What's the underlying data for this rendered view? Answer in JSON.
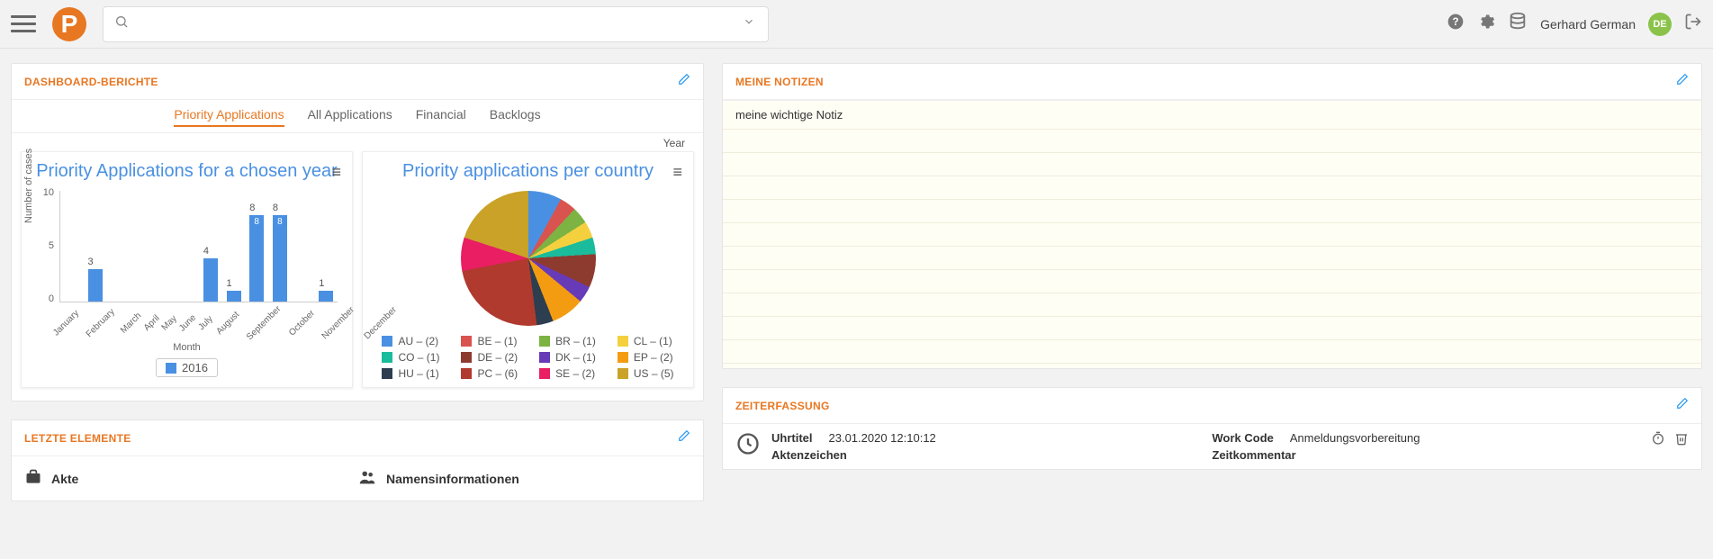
{
  "header": {
    "search_placeholder": "",
    "user_name": "Gerhard German",
    "avatar_initials": "DE"
  },
  "panels": {
    "dashboard": {
      "title": "DASHBOARD-BERICHTE",
      "tabs": [
        "Priority Applications",
        "All Applications",
        "Financial",
        "Backlogs"
      ],
      "active_tab": 0,
      "year_label": "Year"
    },
    "notes": {
      "title": "MEINE NOTIZEN",
      "lines": [
        "meine wichtige Notiz"
      ]
    },
    "recent": {
      "title": "LETZTE ELEMENTE",
      "cols": [
        {
          "icon": "briefcase",
          "label": "Akte"
        },
        {
          "icon": "people",
          "label": "Namensinformationen"
        }
      ]
    },
    "time": {
      "title": "ZEITERFASSUNG",
      "row_label_a": "Uhrtitel",
      "timestamp": "23.01.2020 12:10:12",
      "row_label_b": "Aktenzeichen",
      "workcode_label": "Work Code",
      "workcode_value": "Anmeldungsvorbereitung",
      "comment_label": "Zeitkommentar"
    }
  },
  "chart_data": [
    {
      "type": "bar",
      "title": "Priority Applications for a chosen year",
      "xlabel": "Month",
      "ylabel": "Number of cases",
      "ylim": [
        0,
        10
      ],
      "yticks": [
        0,
        5,
        10
      ],
      "categories": [
        "January",
        "February",
        "March",
        "April",
        "May",
        "June",
        "July",
        "August",
        "September",
        "October",
        "November",
        "December"
      ],
      "values": [
        0,
        3,
        0,
        0,
        0,
        0,
        4,
        1,
        8,
        8,
        0,
        1
      ],
      "legend": "2016"
    },
    {
      "type": "pie",
      "title": "Priority applications per country",
      "series": [
        {
          "name": "AU",
          "value": 2,
          "color": "#4a90e2"
        },
        {
          "name": "BE",
          "value": 1,
          "color": "#d9534f"
        },
        {
          "name": "BR",
          "value": 1,
          "color": "#7cb342"
        },
        {
          "name": "CL",
          "value": 1,
          "color": "#f4d03f"
        },
        {
          "name": "CO",
          "value": 1,
          "color": "#1abc9c"
        },
        {
          "name": "DE",
          "value": 2,
          "color": "#8e3b2f"
        },
        {
          "name": "DK",
          "value": 1,
          "color": "#673ab7"
        },
        {
          "name": "EP",
          "value": 2,
          "color": "#f39c12"
        },
        {
          "name": "HU",
          "value": 1,
          "color": "#2c3e50"
        },
        {
          "name": "PC",
          "value": 6,
          "color": "#b03a2e"
        },
        {
          "name": "SE",
          "value": 2,
          "color": "#e91e63"
        },
        {
          "name": "US",
          "value": 5,
          "color": "#c9a227"
        }
      ]
    }
  ]
}
